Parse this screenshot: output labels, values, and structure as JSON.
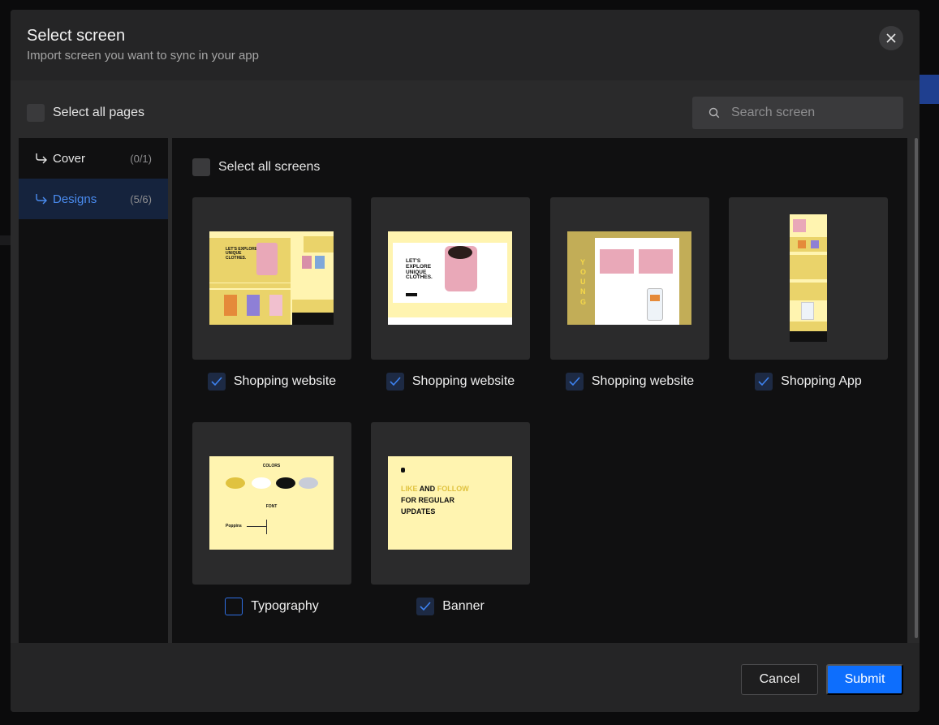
{
  "modal": {
    "title": "Select screen",
    "subtitle": "Import screen you want to sync in your app"
  },
  "toolbar": {
    "select_all_pages_label": "Select all pages",
    "search_placeholder": "Search screen"
  },
  "sidebar": {
    "items": [
      {
        "label": "Cover",
        "count": "(0/1)",
        "active": false
      },
      {
        "label": "Designs",
        "count": "(5/6)",
        "active": true
      }
    ]
  },
  "content": {
    "select_all_screens_label": "Select all screens",
    "screens": [
      {
        "label": "Shopping website",
        "checked": true
      },
      {
        "label": "Shopping website",
        "checked": true
      },
      {
        "label": "Shopping website",
        "checked": true
      },
      {
        "label": "Shopping App",
        "checked": true
      },
      {
        "label": "Typography",
        "checked": false
      },
      {
        "label": "Banner",
        "checked": true
      }
    ],
    "thumb_texts": {
      "hero": "LET'S EXPLORE UNIQUE CLOTHES.",
      "young": "YOUNG",
      "colors": "COLORS",
      "font": "FONT",
      "font_name": "Poppins",
      "banner_line1_a": "LIKE",
      "banner_line1_b": "AND",
      "banner_line1_c": "FOLLOW",
      "banner_line2": "FOR REGULAR",
      "banner_line3": "UPDATES"
    }
  },
  "footer": {
    "cancel_label": "Cancel",
    "submit_label": "Submit"
  },
  "colors": {
    "accent": "#0d6efd",
    "active_text": "#4a8cf0",
    "thumb_yellow": "#fff4b0"
  }
}
